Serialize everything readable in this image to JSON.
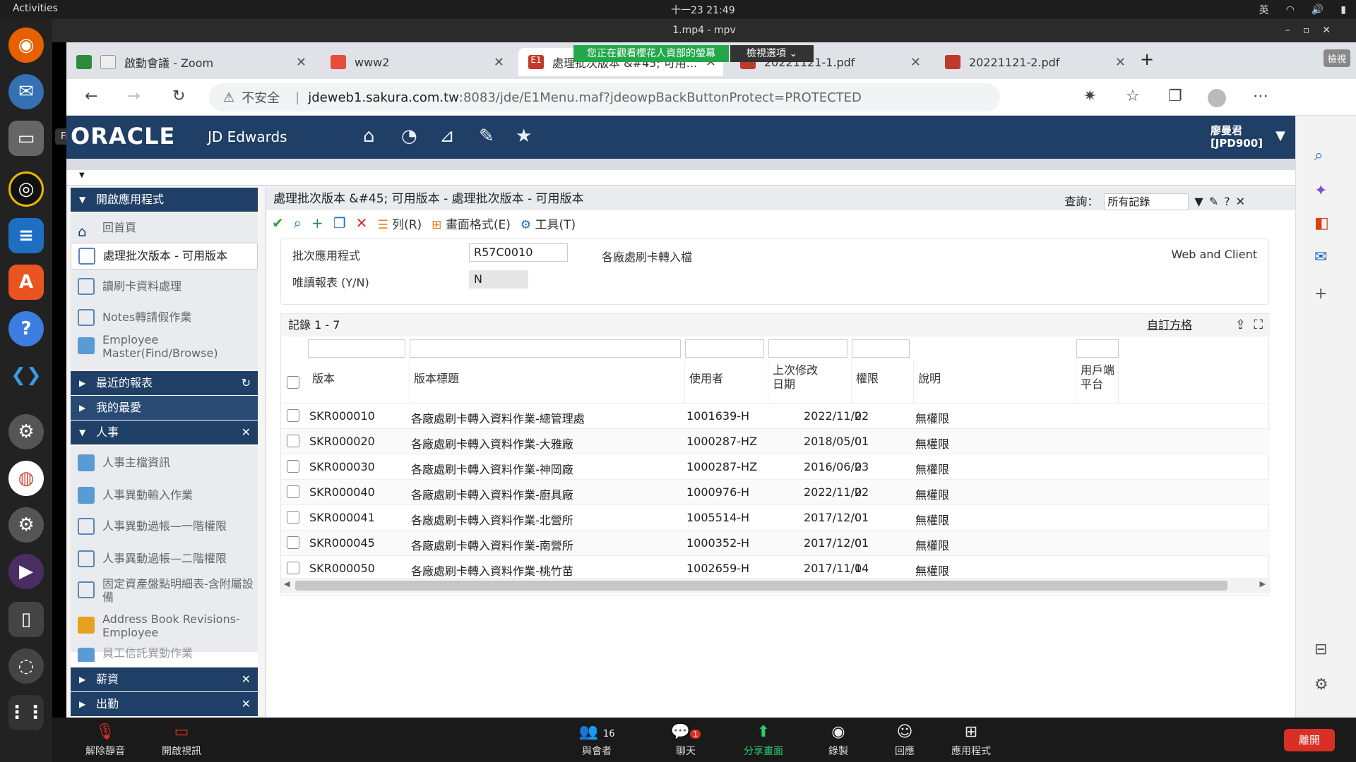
{
  "os": {
    "activities": "Activities",
    "clock": "十一23 21:49",
    "ime": "英",
    "files_tooltip": "Files"
  },
  "player": {
    "title": "1.mp4 - mpv"
  },
  "share": {
    "banner": "您正在觀看櫻花人資部的螢幕",
    "view_options": "檢視選項 ⌄"
  },
  "browser": {
    "tabs": [
      {
        "label": "啟動會議 - Zoom"
      },
      {
        "label": "www2"
      },
      {
        "label": "處理批次版本 &#45; 可用..."
      },
      {
        "label": "20221121-1.pdf"
      },
      {
        "label": "20221121-2.pdf"
      }
    ],
    "view_btn": "檢視",
    "url_warning": "不安全",
    "url_host": "jdeweb1.sakura.com.tw",
    "url_rest": ":8083/jde/E1Menu.maf?jdeowpBackButtonProtect=PROTECTED"
  },
  "jde": {
    "logo": "ORACLE",
    "product": "JD Edwards",
    "user_name": "廖曼君",
    "user_env": "[JPD900]",
    "sidebar": {
      "open_apps": "開啟應用程式",
      "items": [
        {
          "label": "回首頁"
        },
        {
          "label": "處理批次版本 - 可用版本"
        },
        {
          "label": "讀刷卡資料處理"
        },
        {
          "label": "Notes轉請假作業"
        },
        {
          "label": "Employee Master(Find/Browse)"
        }
      ],
      "recent_reports": "最近的報表",
      "favorites": "我的最愛",
      "hr": "人事",
      "hr_items": [
        {
          "label": "人事主檔資訊"
        },
        {
          "label": "人事異動輸入作業"
        },
        {
          "label": "人事異動過帳—一階權限"
        },
        {
          "label": "人事異動過帳—二階權限"
        },
        {
          "label": "固定資產盤點明細表-含附屬設備"
        },
        {
          "label": "Address Book Revisions- Employee"
        },
        {
          "label": "員工信託異動作業"
        }
      ],
      "salary": "薪資",
      "attendance": "出勤"
    },
    "content": {
      "title": "處理批次版本 &#45; 可用版本 - 處理批次版本 - 可用版本",
      "query_label": "查詢：",
      "query_value": "所有記錄",
      "toolbar": {
        "row": "列(R)",
        "layout": "畫面格式(E)",
        "tools": "工具(T)"
      },
      "form": {
        "batch_label": "批次應用程式",
        "batch_value": "R57C0010",
        "batch_desc": "各廠處刷卡轉入檔",
        "readonly_label": "唯讀報表 (Y/N)",
        "readonly_value": "N",
        "platform": "Web and Client"
      },
      "grid": {
        "records": "記錄 1 - 7",
        "customize": "自訂方格",
        "headers": [
          "版本",
          "版本標題",
          "使用者",
          "上次修改\n日期",
          "權限",
          "說明",
          "用戶端\n平台"
        ],
        "rows": [
          [
            "SKR000010",
            "各廠處刷卡轉入資料作業-總管理處",
            "1001639-H",
            "2022/11/22",
            "0",
            "無權限"
          ],
          [
            "SKR000020",
            "各廠處刷卡轉入資料作業-大雅廠",
            "1000287-HZ",
            "2018/05/01",
            "0",
            "無權限"
          ],
          [
            "SKR000030",
            "各廠處刷卡轉入資料作業-神岡廠",
            "1000287-HZ",
            "2016/06/23",
            "0",
            "無權限"
          ],
          [
            "SKR000040",
            "各廠處刷卡轉入資料作業-廚具廠",
            "1000976-H",
            "2022/11/22",
            "0",
            "無權限"
          ],
          [
            "SKR000041",
            "各廠處刷卡轉入資料作業-北營所",
            "1005514-H",
            "2017/12/01",
            "0",
            "無權限"
          ],
          [
            "SKR000045",
            "各廠處刷卡轉入資料作業-南營所",
            "1000352-H",
            "2017/12/01",
            "0",
            "無權限"
          ],
          [
            "SKR000050",
            "各廠處刷卡轉入資料作業-桃竹苗",
            "1002659-H",
            "2017/11/14",
            "0",
            "無權限"
          ]
        ]
      }
    }
  },
  "zoom": {
    "mute": "解除靜音",
    "video": "開啟視訊",
    "participants": "與會者",
    "participants_count": "16",
    "chat": "聊天",
    "chat_badge": "1",
    "share": "分享畫面",
    "record": "錄製",
    "reactions": "回應",
    "apps": "應用程式",
    "leave": "離開"
  }
}
